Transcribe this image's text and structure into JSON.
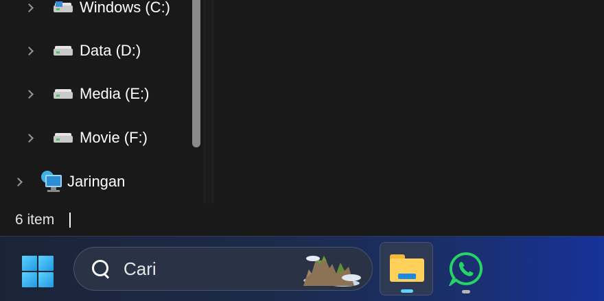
{
  "explorer": {
    "tree": [
      {
        "label": "Windows (C:)",
        "icon": "windows-drive-icon"
      },
      {
        "label": "Data (D:)",
        "icon": "drive-icon"
      },
      {
        "label": "Media (E:)",
        "icon": "drive-icon"
      },
      {
        "label": "Movie (F:)",
        "icon": "drive-icon"
      },
      {
        "label": "Jaringan",
        "icon": "network-icon"
      }
    ],
    "status": "6 item"
  },
  "taskbar": {
    "search_placeholder": "Cari",
    "apps": [
      {
        "name": "File Explorer",
        "icon": "folder-icon",
        "active": true
      },
      {
        "name": "WhatsApp",
        "icon": "whatsapp-icon",
        "active": false
      }
    ]
  },
  "colors": {
    "accent": "#5fd0ff",
    "background": "#191919",
    "whatsapp": "#25d366",
    "folder": "#ffd05a"
  }
}
